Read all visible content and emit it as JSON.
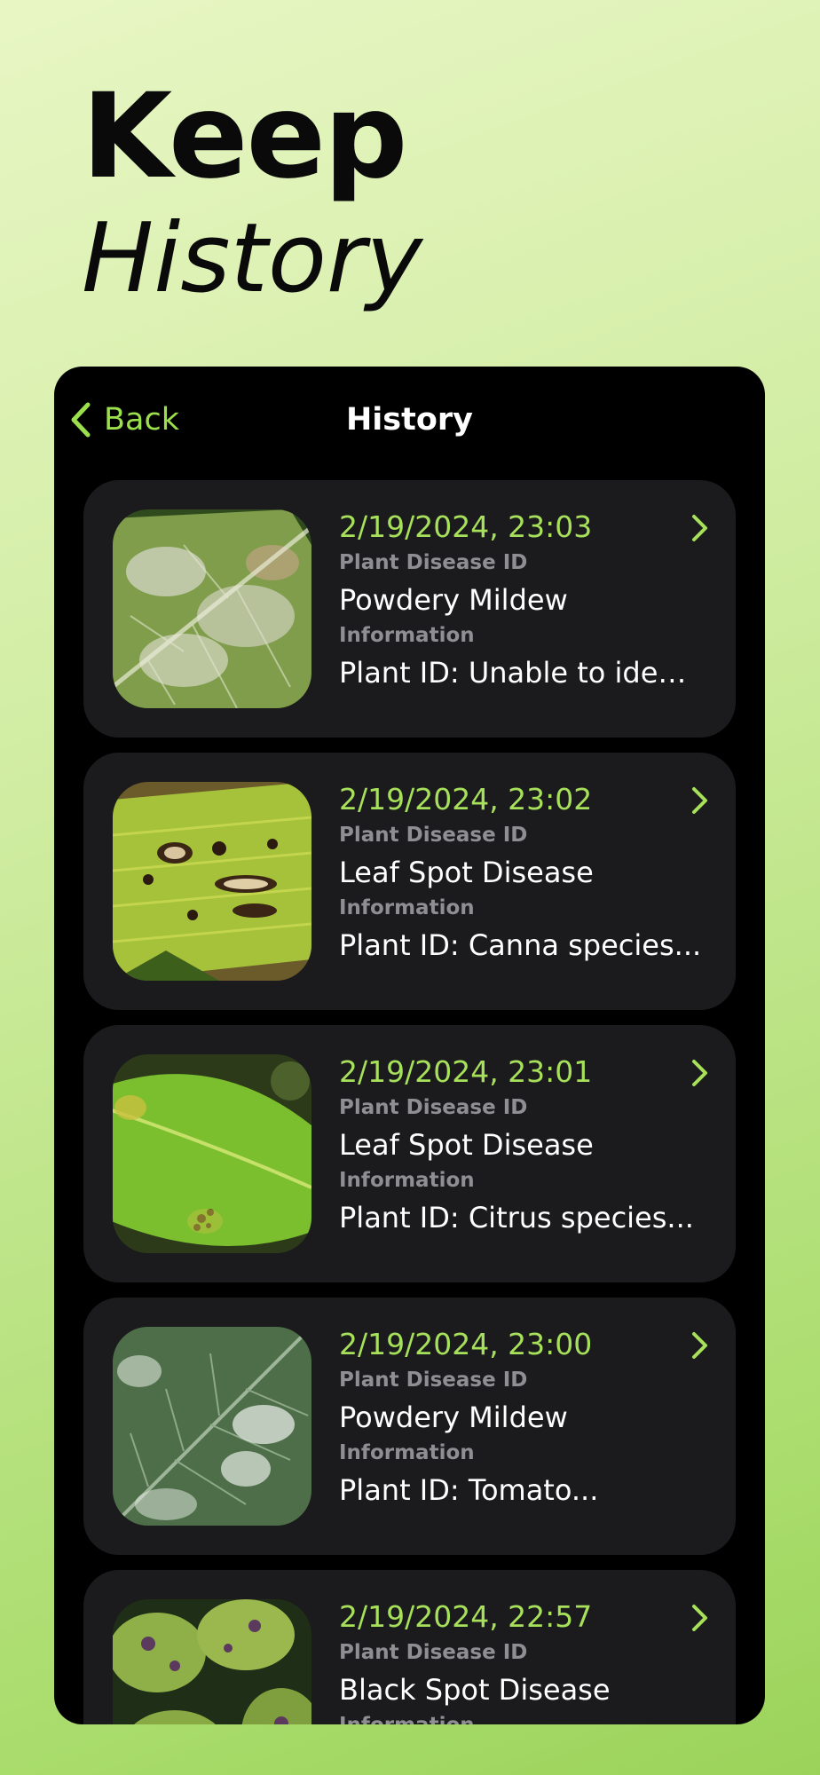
{
  "headline": {
    "line1": "Keep",
    "line2": "History"
  },
  "nav": {
    "back_label": "Back",
    "title": "History"
  },
  "colors": {
    "accent": "#a7e05a",
    "card_bg": "#1b1b1d",
    "label_gray": "#8e8e93"
  },
  "history": [
    {
      "date": "2/19/2024, 23:03",
      "id_label": "Plant Disease ID",
      "disease": "Powdery Mildew",
      "info_label": "Information",
      "info": "Plant ID: Unable to identi...",
      "image": "powdery-mildew-leaf-photo"
    },
    {
      "date": "2/19/2024, 23:02",
      "id_label": "Plant Disease ID",
      "disease": "Leaf Spot Disease",
      "info_label": "Information",
      "info": "Plant ID: Canna species...",
      "image": "canna-leaf-spot-photo"
    },
    {
      "date": "2/19/2024, 23:01",
      "id_label": "Plant Disease ID",
      "disease": "Leaf Spot Disease",
      "info_label": "Information",
      "info": "Plant ID: Citrus species...",
      "image": "citrus-leaf-spot-photo"
    },
    {
      "date": "2/19/2024, 23:00",
      "id_label": "Plant Disease ID",
      "disease": "Powdery Mildew",
      "info_label": "Information",
      "info": "Plant ID: Tomato...",
      "image": "tomato-powdery-mildew-photo"
    },
    {
      "date": "2/19/2024, 22:57",
      "id_label": "Plant Disease ID",
      "disease": "Black Spot Disease",
      "info_label": "Information",
      "info": "",
      "image": "black-spot-leaves-photo"
    }
  ]
}
